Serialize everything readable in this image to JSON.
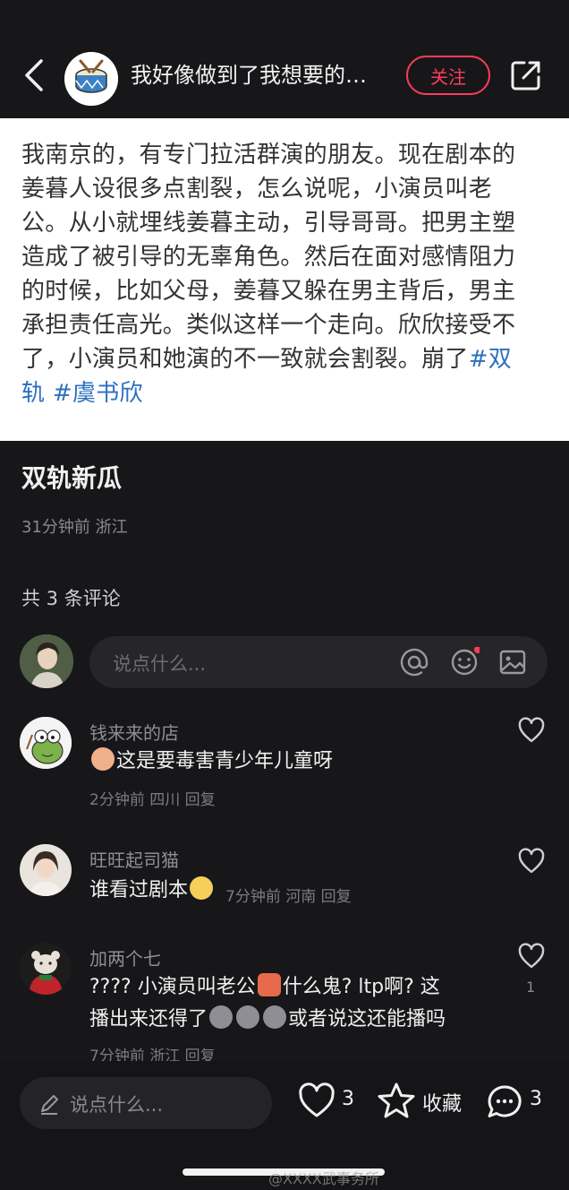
{
  "header": {
    "title": "我好像做到了我想要的…",
    "follow_label": "关注"
  },
  "post": {
    "image_text_lines": [
      "我南京的，有专门拉活群演的朋友。现在剧本的",
      "姜暮人设很多点割裂，怎么说呢，小演员叫老",
      "公。从小就埋线姜暮主动，引导哥哥。把男主塑",
      "造成了被引导的无辜角色。然后在面对感情阻力",
      "的时候，比如父母，姜暮又躲在男主背后，男主",
      "承担责任高光。类似这样一个走向。欣欣接受不",
      "了，小演员和她演的不一致就会割裂。崩了"
    ],
    "tag_inline": "#双",
    "tag_line": "轨 #虞书欣",
    "title": "双轨新瓜",
    "meta": "31分钟前 浙江",
    "comment_count": "共 3 条评论"
  },
  "comment_input": {
    "placeholder": "说点什么..."
  },
  "comments": [
    {
      "name": "钱来来的店",
      "text": "这是要毒害青少年儿童呀",
      "meta": "2分钟前 四川 回复",
      "likes": ""
    },
    {
      "name": "旺旺起司猫",
      "text": "谁看过剧本",
      "meta": "7分钟前 河南 回复",
      "likes": ""
    },
    {
      "name": "加两个七",
      "text_line1": "???? 小演员叫老公",
      "text_line1b": "什么鬼? ltp啊? 这",
      "text_line2": "播出来还得了",
      "text_line2b": "或者说这还能播吗",
      "meta": "7分钟前 浙江 回复",
      "likes": "1"
    }
  ],
  "bottom_bar": {
    "input_placeholder": "说点什么...",
    "likes": "3",
    "collect_label": "收藏",
    "comments": "3"
  },
  "watermark": "@XXXX武事务所",
  "colors": {
    "accent": "#ff3b5a",
    "background": "#17171a",
    "tag": "#2d6fbf"
  }
}
